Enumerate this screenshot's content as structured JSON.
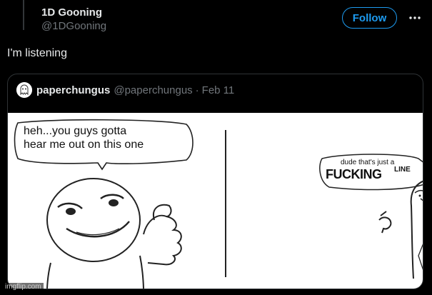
{
  "author": {
    "name": "1D Gooning",
    "handle": "@1DGooning"
  },
  "actions": {
    "follow_label": "Follow",
    "more_icon": "more-horizontal-icon"
  },
  "tweet": {
    "text": "I'm listening"
  },
  "quote": {
    "name": "paperchungus",
    "handle": "@paperchungus",
    "separator": "·",
    "date": "Feb 11",
    "avatar_icon": "ghost-avatar-icon"
  },
  "comic": {
    "speech_left_line1": "heh...you guys gotta",
    "speech_left_line2": "hear me out on this one",
    "speech_right_small": "dude that's just a",
    "speech_right_big": "FUCKING",
    "speech_right_line": "LINE"
  },
  "watermark": "imgflip.com",
  "colors": {
    "accent": "#1d9bf0",
    "background": "#000000",
    "muted": "#71767b"
  }
}
